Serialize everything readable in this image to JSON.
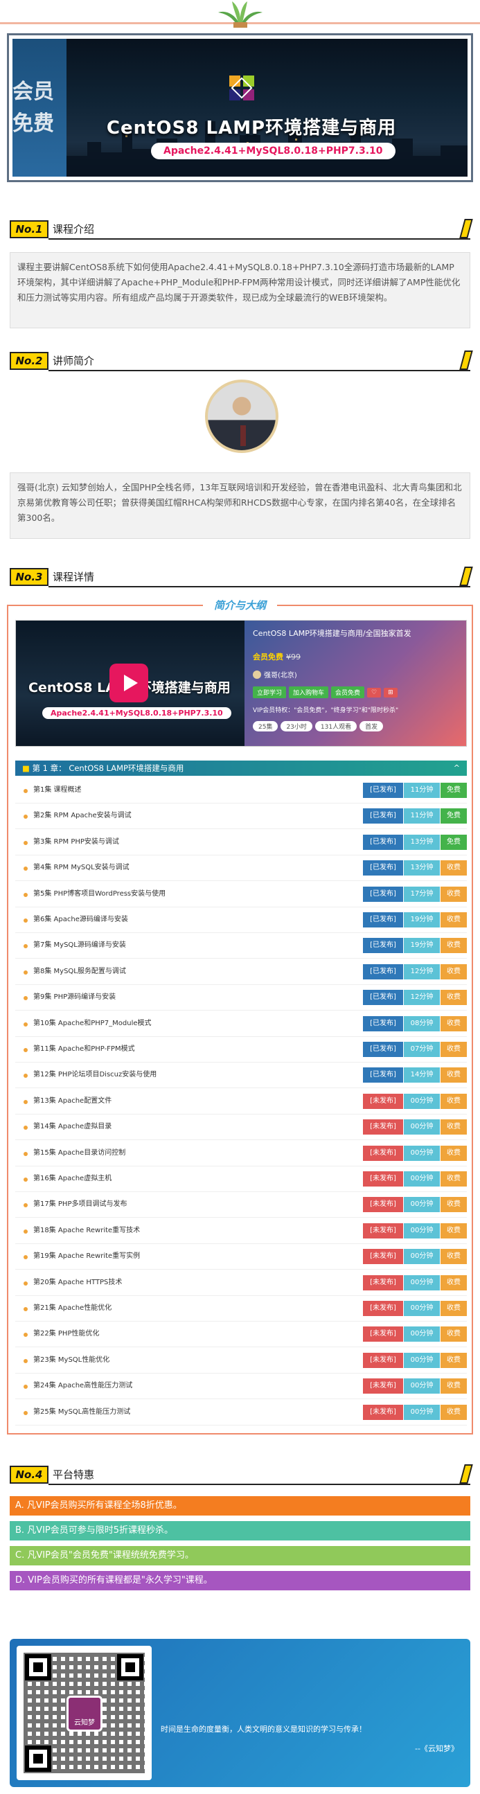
{
  "hero": {
    "side_label": "会员免费",
    "title": "CentOS8 LAMP环境搭建与商用",
    "subtitle": "Apache2.4.41+MySQL8.0.18+PHP7.3.10"
  },
  "sections": {
    "intro": {
      "num": "No.1",
      "title": "课程介绍",
      "text": "课程主要讲解CentOS8系统下如何使用Apache2.4.41+MySQL8.0.18+PHP7.3.10全源码打造市场最新的LAMP环境架构，其中详细讲解了Apache+PHP_Module和PHP-FPM两种常用设计模式，同时还详细讲解了AMP性能优化和压力测试等实用内容。所有组成产品均属于开源类软件，现已成为全球最流行的WEB环境架构。"
    },
    "teacher": {
      "num": "No.2",
      "title": "讲师简介",
      "text": "强哥(北京) 云知梦创始人，全国PHP全栈名师，13年互联网培训和开发经验，曾在香港电讯盈科、北大青鸟集团和北京易第优教育等公司任职；曾获得美国红帽RHCA构架师和RHCDS数据中心专家，在国内排名第40名，在全球排名第300名。"
    },
    "details": {
      "num": "No.3",
      "title": "课程详情",
      "tag": "简介与大纲"
    },
    "benefits": {
      "num": "No.4",
      "title": "平台特惠"
    }
  },
  "video": {
    "thumb_title": "CentOS8 LAMP环境搭建与商用",
    "thumb_sub": "Apache2.4.41+MySQL8.0.18+PHP7.3.10",
    "info_title": "CentOS8 LAMP环境搭建与商用/全国独家首发",
    "free_label": "会员免费",
    "old_price": "¥99",
    "teacher": "强哥(北京)",
    "buttons": [
      "立即学习",
      "加入购物车",
      "会员免费"
    ],
    "vip_note": "VIP会员特权：\"会员免费\"，\"终身学习\"和\"限时秒杀\"",
    "tags": [
      "25集",
      "23小时",
      "131人观看",
      "首发"
    ]
  },
  "chapter": {
    "label": "第 1 章：   CentOS8 LAMP环境搭建与商用",
    "toggle": "^"
  },
  "lessons": [
    {
      "name": "第1集 课程概述",
      "status": "[已发布]",
      "dur": "11分钟",
      "access": "免费"
    },
    {
      "name": "第2集 RPM Apache安装与调试",
      "status": "[已发布]",
      "dur": "11分钟",
      "access": "免费"
    },
    {
      "name": "第3集 RPM PHP安装与调试",
      "status": "[已发布]",
      "dur": "13分钟",
      "access": "免费"
    },
    {
      "name": "第4集 RPM MySQL安装与调试",
      "status": "[已发布]",
      "dur": "13分钟",
      "access": "收费"
    },
    {
      "name": "第5集 PHP博客项目WordPress安装与使用",
      "status": "[已发布]",
      "dur": "17分钟",
      "access": "收费"
    },
    {
      "name": "第6集 Apache源码编译与安装",
      "status": "[已发布]",
      "dur": "19分钟",
      "access": "收费"
    },
    {
      "name": "第7集 MySQL源码编译与安装",
      "status": "[已发布]",
      "dur": "19分钟",
      "access": "收费"
    },
    {
      "name": "第8集 MySQL服务配置与调试",
      "status": "[已发布]",
      "dur": "12分钟",
      "access": "收费"
    },
    {
      "name": "第9集 PHP源码编译与安装",
      "status": "[已发布]",
      "dur": "12分钟",
      "access": "收费"
    },
    {
      "name": "第10集 Apache和PHP7_Module模式",
      "status": "[已发布]",
      "dur": "08分钟",
      "access": "收费"
    },
    {
      "name": "第11集 Apache和PHP-FPM模式",
      "status": "[已发布]",
      "dur": "07分钟",
      "access": "收费"
    },
    {
      "name": "第12集 PHP论坛项目Discuz安装与使用",
      "status": "[已发布]",
      "dur": "14分钟",
      "access": "收费"
    },
    {
      "name": "第13集 Apache配置文件",
      "status": "[未发布]",
      "dur": "00分钟",
      "access": "收费"
    },
    {
      "name": "第14集 Apache虚拟目录",
      "status": "[未发布]",
      "dur": "00分钟",
      "access": "收费"
    },
    {
      "name": "第15集 Apache目录访问控制",
      "status": "[未发布]",
      "dur": "00分钟",
      "access": "收费"
    },
    {
      "name": "第16集 Apache虚拟主机",
      "status": "[未发布]",
      "dur": "00分钟",
      "access": "收费"
    },
    {
      "name": "第17集 PHP多项目调试与发布",
      "status": "[未发布]",
      "dur": "00分钟",
      "access": "收费"
    },
    {
      "name": "第18集 Apache Rewrite重写技术",
      "status": "[未发布]",
      "dur": "00分钟",
      "access": "收费"
    },
    {
      "name": "第19集 Apache Rewrite重写实例",
      "status": "[未发布]",
      "dur": "00分钟",
      "access": "收费"
    },
    {
      "name": "第20集 Apache HTTPS技术",
      "status": "[未发布]",
      "dur": "00分钟",
      "access": "收费"
    },
    {
      "name": "第21集 Apache性能优化",
      "status": "[未发布]",
      "dur": "00分钟",
      "access": "收费"
    },
    {
      "name": "第22集 PHP性能优化",
      "status": "[未发布]",
      "dur": "00分钟",
      "access": "收费"
    },
    {
      "name": "第23集 MySQL性能优化",
      "status": "[未发布]",
      "dur": "00分钟",
      "access": "收费"
    },
    {
      "name": "第24集 Apache高性能压力测试",
      "status": "[未发布]",
      "dur": "00分钟",
      "access": "收费"
    },
    {
      "name": "第25集 MySQL高性能压力测试",
      "status": "[未发布]",
      "dur": "00分钟",
      "access": "收费"
    }
  ],
  "benefits": [
    {
      "text": "A. 凡VIP会员购买所有课程全场8折优惠。",
      "color": "#f47d20"
    },
    {
      "text": "B. 凡VIP会员可参与限时5折课程秒杀。",
      "color": "#4dc1a2"
    },
    {
      "text": "C. 凡VIP会员\"会员免费\"课程统统免费学习。",
      "color": "#90c95a"
    },
    {
      "text": "D. VIP会员购买的所有课程都是\"永久学习\"课程。",
      "color": "#a656c0"
    }
  ],
  "footer": {
    "logo_text": "云知梦",
    "quote": "时间是生命的度量衡，人类文明的意义是知识的学习与传承！",
    "author": "--《云知梦》"
  },
  "colors": {
    "published": "#2f78b8",
    "unpublished": "#e05555",
    "free": "#44b34a",
    "paid": "#f0a43a"
  }
}
